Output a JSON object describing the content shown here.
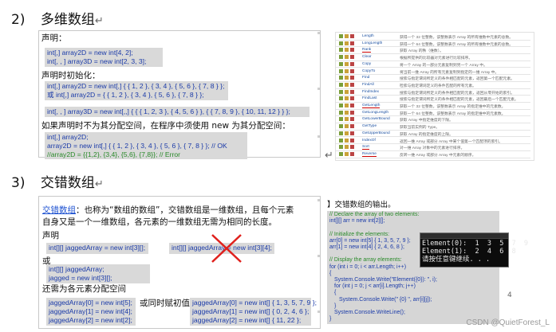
{
  "section1": {
    "number": "2)",
    "title": "多维数组",
    "return_mark": "↵",
    "declare_label": "声明：",
    "declare_code": [
      "int[,] array2D = new int[4, 2];",
      "int[, , ] array3D = new int[2, 3, 3];"
    ],
    "init_label": "声明时初始化：",
    "init_code_a": [
      "int[,] array2D = new int[,] { { 1, 2 }, { 3, 4 }, { 5, 6 }, { 7, 8 } };",
      "或 int[,] array2D = { { 1, 2 }, { 3, 4 }, { 5, 6 }, { 7, 8 } };"
    ],
    "init_code_b": "int[, , ] array3D = new int[,,] { { { 1, 2, 3 }, { 4, 5, 6 } }, { { 7, 8, 9 }, { 10, 11, 12 } } };",
    "note": "如果声明时不为其分配空间，在程序中须使用 new 为其分配空间：",
    "alloc_code": [
      "int[,] array2D;",
      "array2D = new int[,] { { 1, 2 }, { 3, 4 }, { 5, 6 }, { 7, 8 } }; // OK",
      "//array2D = {{1,2}, {3,4}, {5,6}, {7,8}}; // Error"
    ],
    "bottom_return_mark": "↵"
  },
  "section2": {
    "number": "3)",
    "title": "交错数组",
    "return_mark": "↵",
    "intro_term": "交错数组",
    "intro_text_1": "：也称为“数组的数组”，交错数组是一维数组，且每个元素",
    "intro_text_2": "自身又是一个一维数组，各元素的一维数组无需为相同的长度。",
    "declare_label": "声明",
    "declare_ok": "int[][] jaggedArray = new int[3][];",
    "declare_bad": "int[][] jaggedArray = new int[3][4];",
    "or_label": "或",
    "declare_alt": [
      "int[][] jaggedArray;",
      "jagged = new int[3][];"
    ],
    "alloc_label": "还需为各元素分配空间",
    "alloc_code": [
      "jaggedArray[0] = new int[5];",
      "jaggedArray[1] = new int[4];",
      "jaggedArray[2] = new int[2];"
    ],
    "assign_label": "或同时赋初值",
    "assign_code": [
      "jaggedArray[0] = new int[] { 1, 3, 5, 7, 9 };",
      "jaggedArray[1] = new int[] { 0, 2, 4, 6 };",
      "jaggedArray[2] = new int[] { 11, 22 };"
    ]
  },
  "example": {
    "heading": "】交错数组的输出。",
    "code": [
      "// Declare the array of two elements:",
      "int[][] arr = new int[2][];",
      "",
      "// Initialize the elements:",
      "arr[0] = new int[5] { 1, 3, 5, 7, 9 };",
      "arr[1] = new int[4] { 2, 4, 6, 8 };",
      "",
      "// Display the array elements:",
      "for (int i = 0; i < arr.Length; i++)",
      "{",
      "    System.Console.Write(\"Element({0}): \", i);",
      "    for (int j = 0; j < arr[i].Length; j++)",
      "    {",
      "        System.Console.Write(\" {0} \", arr[i][j]);",
      "    }",
      "    System.Console.WriteLine();",
      "}"
    ],
    "console_lines": [
      "Element(0):  1  3  5  7  9",
      "Element(1):  2  4  6  8",
      "请按任意键继续. . ."
    ],
    "page_marker": "4"
  },
  "ref_table": {
    "rows": [
      {
        "name": "Length",
        "desc": "获得一个 32 位整数，该整数表示 Array 的所有维数中元素的总数。"
      },
      {
        "name": "LongLength",
        "desc": "获得一个 64 位整数，该整数表示 Array 的所有维数中元素的总数。"
      },
      {
        "name": "Rank",
        "desc": "获取 Array 的秩（维数）。"
      },
      {
        "name": "Clear",
        "desc": "根据所提供的比较器对元素进行比较排序。"
      },
      {
        "name": "Copy",
        "desc": "将一个 Array 的一部分元素复制到另一个 Array 中。"
      },
      {
        "name": "CopyTo",
        "desc": "将当前一维 Array 的所有元素复制到指定的一维 Array 中。"
      },
      {
        "name": "Find",
        "desc": "搜索与指定谓词所定义的条件相匹配的元素，返回第一个匹配元素。"
      },
      {
        "name": "FindAll",
        "desc": "检索与指定谓词定义的条件匹配的所有元素。"
      },
      {
        "name": "FindIndex",
        "desc": "搜索与指定谓词所定义的条件相匹配的元素，返回从零开始的索引。"
      },
      {
        "name": "FindLast",
        "desc": "搜索与指定谓词所定义的条件相匹配的元素，返回最后一个匹配元素。"
      },
      {
        "name": "GetLength",
        "desc": "获取一个 32 位整数，该整数表示 Array 的指定维中的元素数。"
      },
      {
        "name": "GetLongLength",
        "desc": "获取一个 64 位整数，该整数表示 Array 的指定维中的元素数。"
      },
      {
        "name": "GetLowerBound",
        "desc": "获取 Array 中指定维度的下限。"
      },
      {
        "name": "GetType",
        "desc": "获取当前实例的 Type。"
      },
      {
        "name": "GetUpperBound",
        "desc": "获取 Array 的指定维度的上限。"
      },
      {
        "name": "IndexOf",
        "desc": "返回一维 Array 或部分 Array 中某个值第一个匹配项的索引。"
      },
      {
        "name": "Sort",
        "desc": "对一维 Array 对象中的元素进行排序。"
      },
      {
        "name": "Reverse",
        "desc": "反转一维 Array 或部分 Array 中元素的顺序。"
      }
    ],
    "return_mark": "↵"
  },
  "watermark": "CSDN @QuietForest_L"
}
